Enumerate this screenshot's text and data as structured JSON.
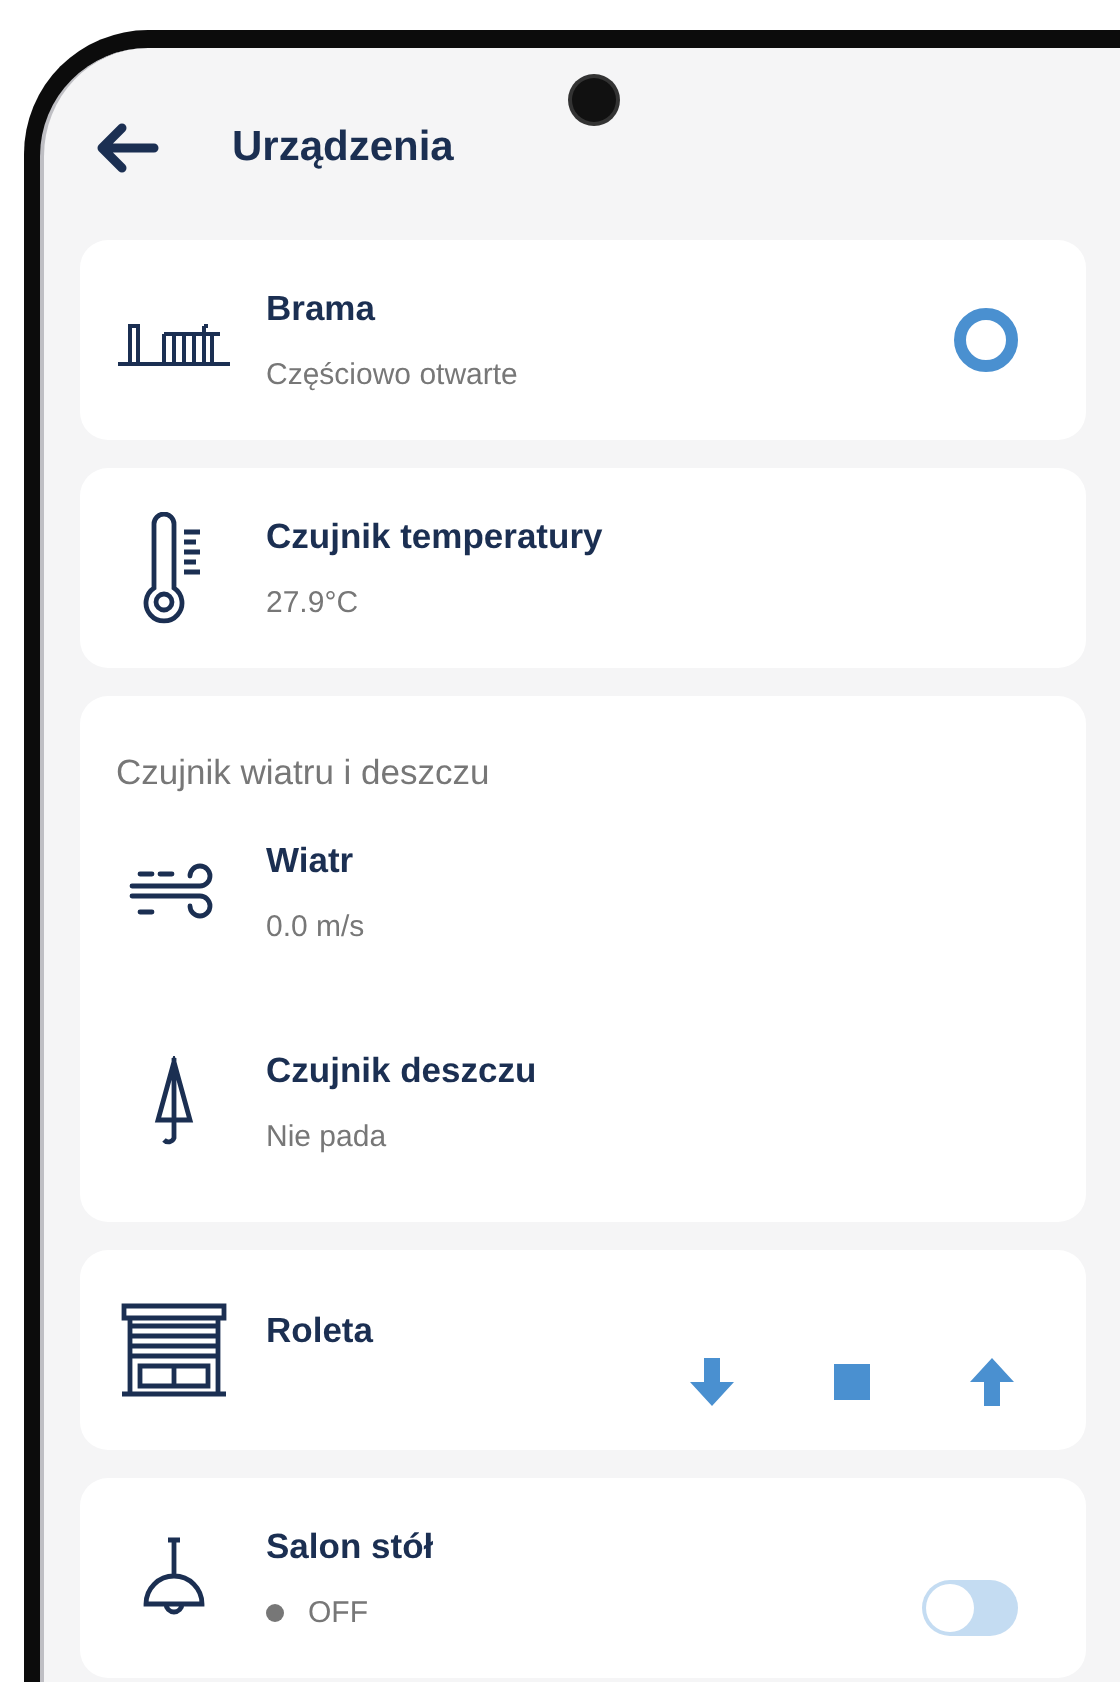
{
  "header": {
    "title": "Urządzenia"
  },
  "devices": [
    {
      "kind": "gate",
      "name": "Brama",
      "status": "Częściowo otwarte"
    },
    {
      "kind": "thermometer",
      "name": "Czujnik temperatury",
      "status": "27.9°C"
    },
    {
      "kind": "group",
      "title": "Czujnik wiatru i deszczu",
      "children": [
        {
          "kind": "wind",
          "name": "Wiatr",
          "status": "0.0 m/s"
        },
        {
          "kind": "rain",
          "name": "Czujnik deszczu",
          "status": "Nie pada"
        }
      ]
    },
    {
      "kind": "blind",
      "name": "Roleta"
    },
    {
      "kind": "light",
      "name": "Salon stół",
      "status": "OFF",
      "on": false
    }
  ]
}
